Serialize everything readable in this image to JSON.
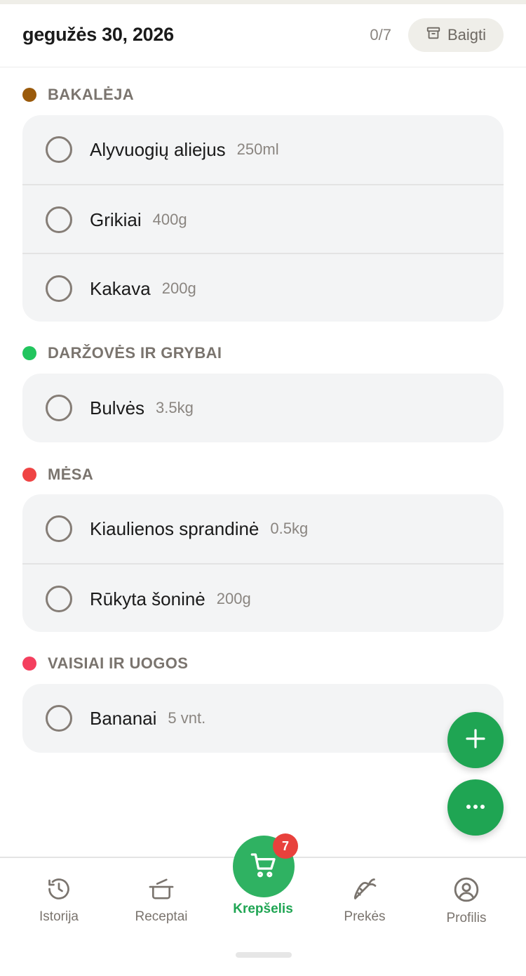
{
  "header": {
    "date": "gegužės 30, 2026",
    "progress": "0/7",
    "finish_label": "Baigti"
  },
  "categories": [
    {
      "name": "BAKALĖJA",
      "color": "#9a5a0b",
      "items": [
        {
          "name": "Alyvuogių aliejus",
          "qty": "250ml",
          "checked": false
        },
        {
          "name": "Grikiai",
          "qty": "400g",
          "checked": false
        },
        {
          "name": "Kakava",
          "qty": "200g",
          "checked": false
        }
      ]
    },
    {
      "name": "DARŽOVĖS IR GRYBAI",
      "color": "#22c55e",
      "items": [
        {
          "name": "Bulvės",
          "qty": "3.5kg",
          "checked": false
        }
      ]
    },
    {
      "name": "MĖSA",
      "color": "#ef4444",
      "items": [
        {
          "name": "Kiaulienos sprandinė",
          "qty": "0.5kg",
          "checked": false
        },
        {
          "name": "Rūkyta šoninė",
          "qty": "200g",
          "checked": false
        }
      ]
    },
    {
      "name": "VAISIAI IR UOGOS",
      "color": "#f43f5e",
      "items": [
        {
          "name": "Bananai",
          "qty": "5 vnt.",
          "checked": false
        }
      ]
    }
  ],
  "fabs": {
    "add_icon": "plus-icon",
    "more_icon": "more-icon"
  },
  "nav": {
    "items": [
      {
        "label": "Istorija",
        "icon": "history-icon"
      },
      {
        "label": "Receptai",
        "icon": "pot-icon"
      },
      {
        "label": "Krepšelis",
        "icon": "cart-icon",
        "active": true
      },
      {
        "label": "Prekės",
        "icon": "carrot-icon"
      },
      {
        "label": "Profilis",
        "icon": "profile-icon"
      }
    ],
    "cart_badge": "7"
  },
  "colors": {
    "accent": "#1fa553",
    "badge": "#e8413c"
  }
}
